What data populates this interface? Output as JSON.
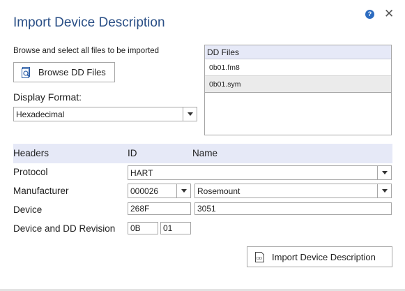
{
  "dialog": {
    "title": "Import Device Description",
    "help_symbol": "?",
    "close_symbol": "✕"
  },
  "browse": {
    "instruction": "Browse and select all files to be imported",
    "button_label": "Browse DD Files"
  },
  "display_format": {
    "label": "Display Format:",
    "value": "Hexadecimal"
  },
  "dd_files": {
    "header": "DD Files",
    "items": [
      "0b01.fm8",
      "0b01.sym"
    ]
  },
  "grid": {
    "headers": [
      "Headers",
      "ID",
      "Name"
    ],
    "protocol": {
      "label": "Protocol",
      "value": "HART"
    },
    "manufacturer": {
      "label": "Manufacturer",
      "id": "000026",
      "name": "Rosemount"
    },
    "device": {
      "label": "Device",
      "id": "268F",
      "name": "3051"
    },
    "revision": {
      "label": "Device and DD Revision",
      "device_rev": "0B",
      "dd_rev": "01"
    }
  },
  "import_button": {
    "label": "Import Device Description",
    "icon_text": "DD"
  },
  "colors": {
    "title": "#2a4f86",
    "header_band": "#e6e9f7",
    "help_icon": "#2d6cc0"
  }
}
